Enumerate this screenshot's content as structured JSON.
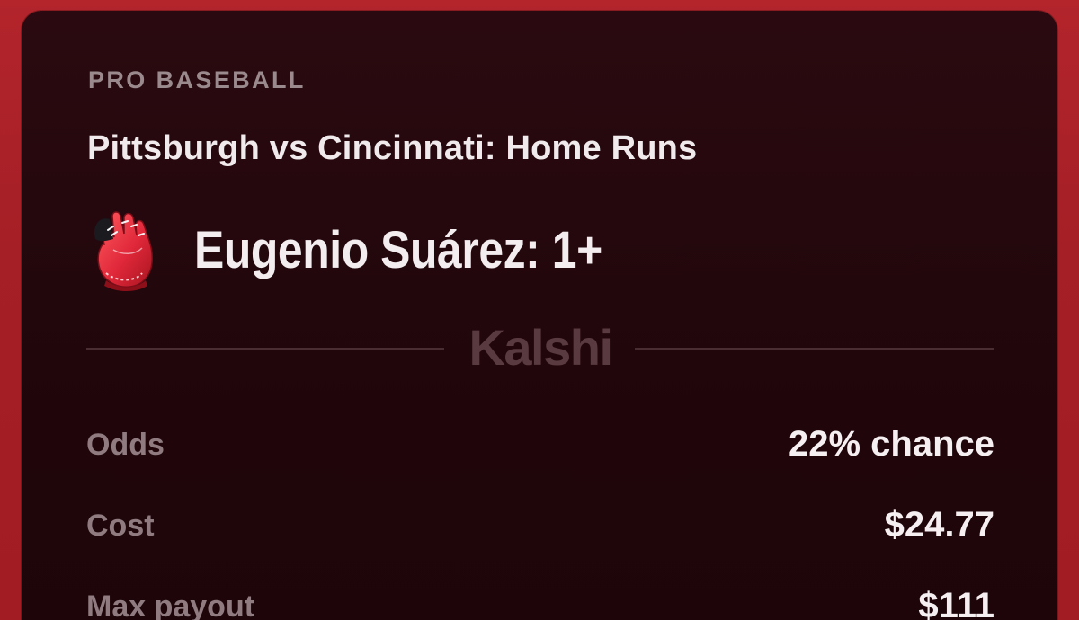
{
  "card": {
    "category": "PRO BASEBALL",
    "matchup": "Pittsburgh vs Cincinnati: Home Runs",
    "pick": "Eugenio Suárez: 1+",
    "pick_icon": "baseball-glove-icon",
    "brand": "Kalshi"
  },
  "details": {
    "odds_label": "Odds",
    "odds_value": "22% chance",
    "cost_label": "Cost",
    "cost_value": "$24.77",
    "payout_label": "Max payout",
    "payout_value": "$111"
  },
  "colors": {
    "background": "#a51f26",
    "card": "#22070c",
    "accent": "#d8263a",
    "muted_text": "#9a8a8e",
    "primary_text": "#f3edef"
  }
}
